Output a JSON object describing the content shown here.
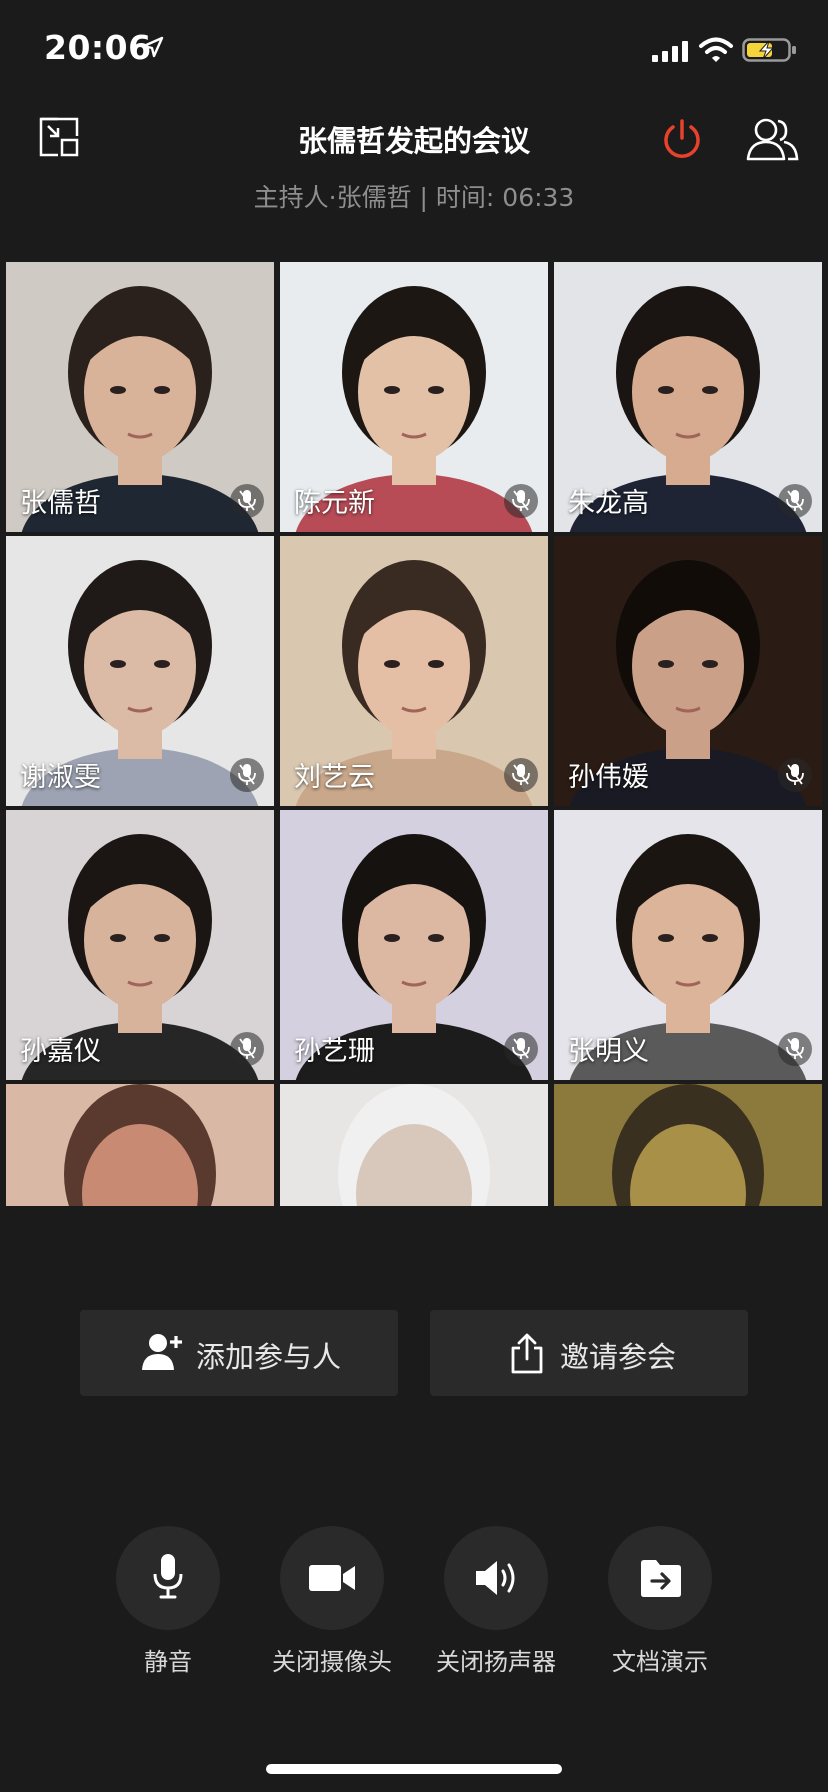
{
  "status_bar": {
    "time": "20:06"
  },
  "header": {
    "title": "张儒哲发起的会议",
    "subtitle": "主持人·张儒哲 | 时间: 06:33",
    "accent_color": "#e8412c"
  },
  "participants": [
    {
      "name": "张儒哲",
      "bg": "#cfcac4",
      "skin": "#d8b39a",
      "shirt": "#1f2733",
      "hair": "#2a211c"
    },
    {
      "name": "陈元新",
      "bg": "#e8ecef",
      "skin": "#e3c1a7",
      "shirt": "#b84c56",
      "hair": "#1d1714"
    },
    {
      "name": "朱龙高",
      "bg": "#e2e4e8",
      "skin": "#d6ab8f",
      "shirt": "#1e2434",
      "hair": "#1a1412"
    },
    {
      "name": "谢淑雯",
      "bg": "#e6e6e6",
      "skin": "#dcbba6",
      "shirt": "#9da3b3",
      "hair": "#1f1a18"
    },
    {
      "name": "刘艺云",
      "bg": "#d9c7b0",
      "skin": "#e4bfa5",
      "shirt": "#c9a78a",
      "hair": "#3a2b22"
    },
    {
      "name": "孙伟媛",
      "bg": "#2a1c14",
      "skin": "#caa088",
      "shirt": "#1a1a24",
      "hair": "#120c09"
    },
    {
      "name": "孙嘉仪",
      "bg": "#d8d4d6",
      "skin": "#d8b39c",
      "shirt": "#262626",
      "hair": "#1b1614"
    },
    {
      "name": "孙艺珊",
      "bg": "#d4d0e0",
      "skin": "#dcb8a2",
      "shirt": "#1c1c1c",
      "hair": "#161210"
    },
    {
      "name": "张明义",
      "bg": "#e4e4ea",
      "skin": "#dbb49a",
      "shirt": "#5a5a5a",
      "hair": "#1b1512"
    }
  ],
  "partial_tiles": [
    {
      "bg": "#d9b9a6",
      "skin": "#c98a74",
      "hair": "#5a3a2e"
    },
    {
      "bg": "#e8e6e4",
      "skin": "#d8c8bc",
      "hair": "#f0f0f0"
    },
    {
      "bg": "#8c7a3c",
      "skin": "#a89048",
      "hair": "#3a3020"
    }
  ],
  "actions": {
    "add_participant": "添加参与人",
    "invite": "邀请参会"
  },
  "controls": {
    "mute": "静音",
    "camera_off": "关闭摄像头",
    "speaker_off": "关闭扬声器",
    "doc_present": "文档演示"
  }
}
